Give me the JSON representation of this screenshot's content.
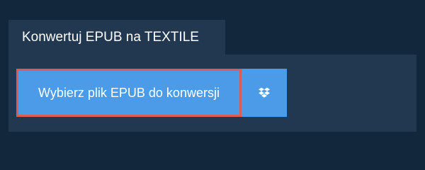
{
  "tab": {
    "title": "Konwertuj EPUB na TEXTILE"
  },
  "actions": {
    "choose_file_label": "Wybierz plik EPUB do konwersji",
    "dropbox_icon": "dropbox-icon"
  },
  "colors": {
    "page_background": "#12263c",
    "panel_background": "#223850",
    "button_background": "#4b9be8",
    "button_focus_border": "#de5b53",
    "text": "#ffffff"
  }
}
